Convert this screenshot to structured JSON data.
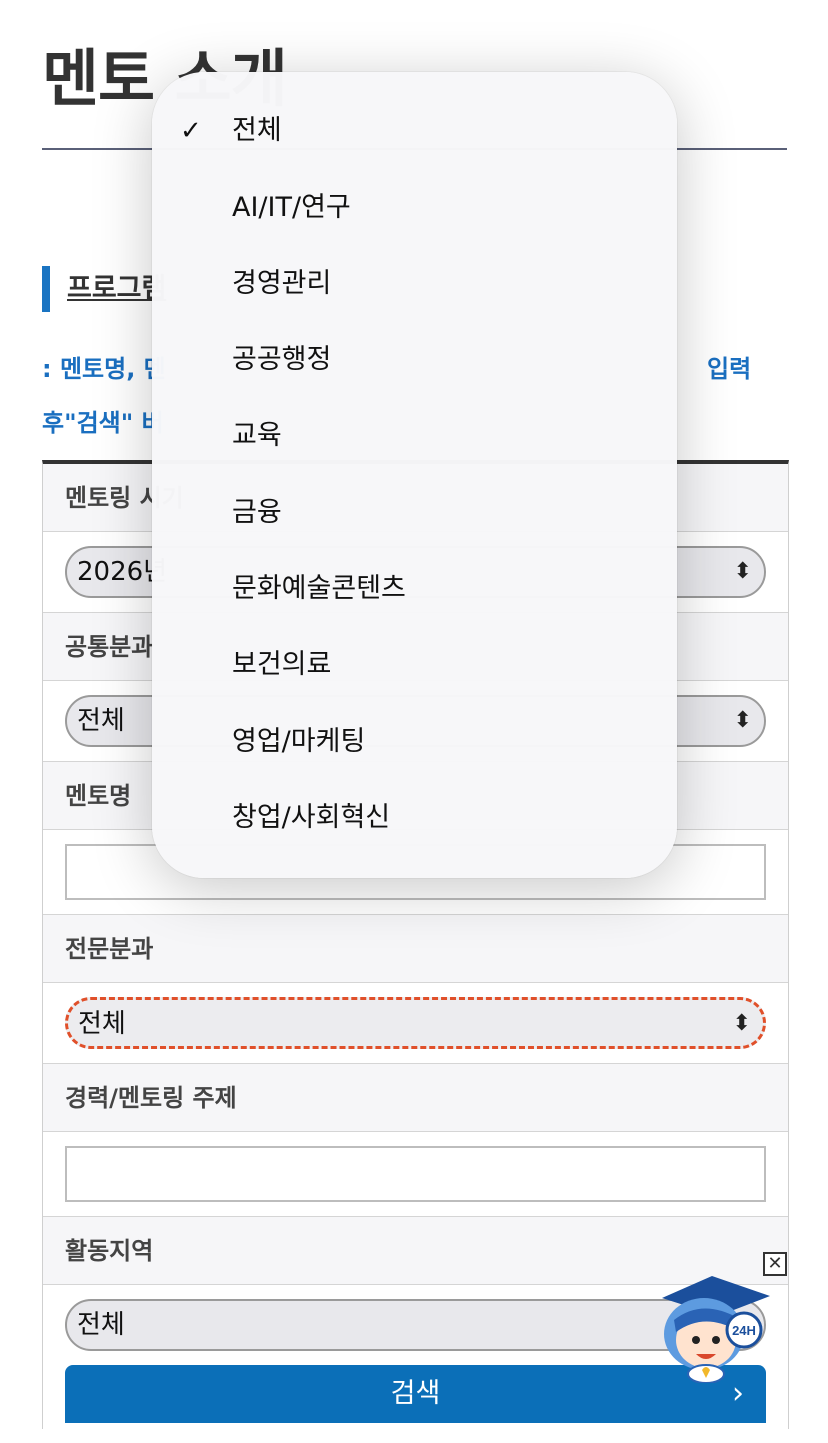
{
  "page": {
    "title": "멘토 소개",
    "section_heading": "프로그램",
    "help_line1_left": ": 멘토명, 멘",
    "help_line1_right": "입력",
    "help_line2": "후\"검색\" 버"
  },
  "form": {
    "rows": [
      {
        "label": "멘토링 시기",
        "type": "select",
        "value": "2026년"
      },
      {
        "label": "공통분과",
        "type": "select",
        "value": "전체"
      },
      {
        "label": "멘토명",
        "type": "text",
        "value": ""
      },
      {
        "label": "전문분과",
        "type": "select",
        "value": "전체",
        "focused": true
      },
      {
        "label": "경력/멘토링 주제",
        "type": "text",
        "value": ""
      },
      {
        "label": "활동지역",
        "type": "select",
        "value": "전체"
      }
    ],
    "search_label": "검색"
  },
  "popup": {
    "selected_index": 0,
    "options": [
      "전체",
      "AI/IT/연구",
      "경영관리",
      "공공행정",
      "교육",
      "금융",
      "문화예술콘텐츠",
      "보건의료",
      "영업/마케팅",
      "창업/사회혁신"
    ]
  },
  "chatbot": {
    "badge": "24H"
  },
  "colors": {
    "accent": "#1a74c2",
    "button": "#0b6fb8",
    "focus": "#e0502a"
  }
}
